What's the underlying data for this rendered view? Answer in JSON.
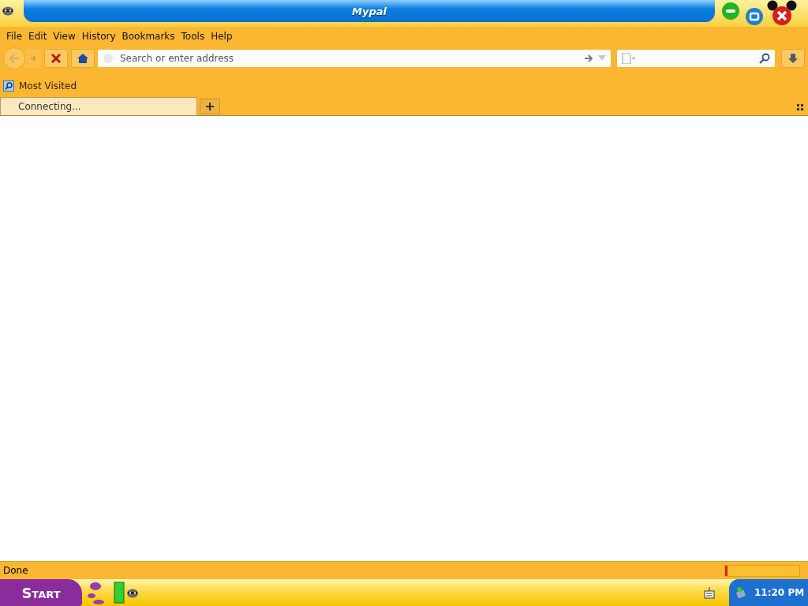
{
  "window": {
    "title": "Mypal"
  },
  "menu": [
    "File",
    "Edit",
    "View",
    "History",
    "Bookmarks",
    "Tools",
    "Help"
  ],
  "address_bar": {
    "placeholder": "Search or enter address"
  },
  "bookmarks": [
    {
      "label": "Most Visited"
    }
  ],
  "tabs": [
    {
      "label": "Connecting...",
      "selected": true
    }
  ],
  "status_bar": {
    "text": "Done",
    "progress": {
      "level": 0.03
    }
  },
  "taskbar": {
    "start": "Start",
    "clock": "11:20 PM"
  }
}
